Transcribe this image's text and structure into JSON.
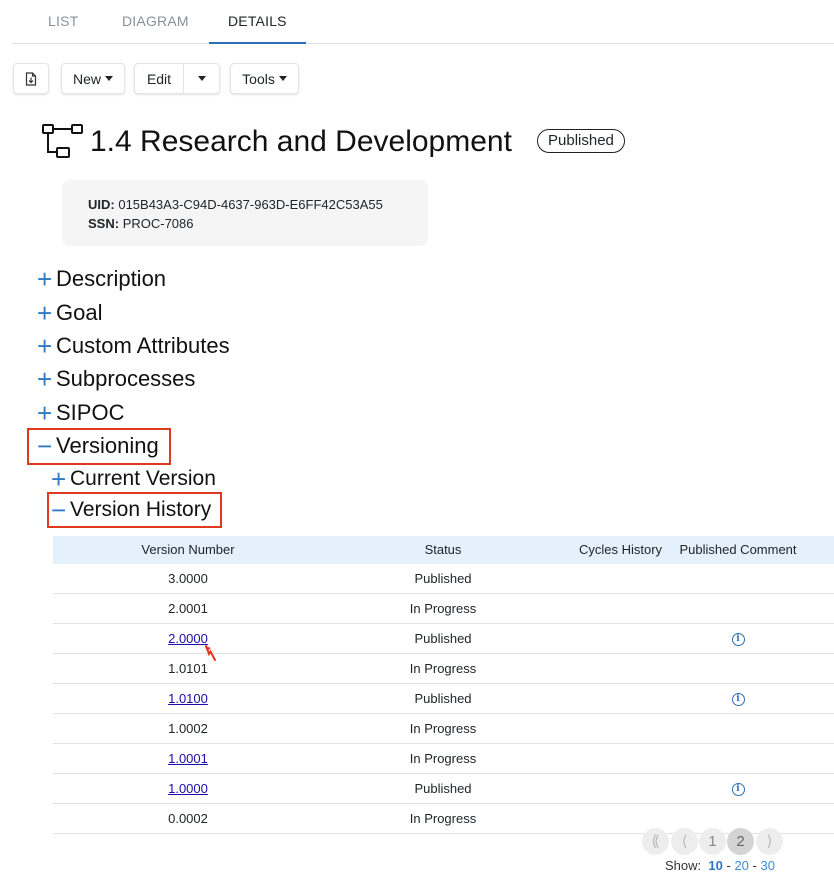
{
  "tabs": [
    {
      "label": "LIST"
    },
    {
      "label": "DIAGRAM"
    },
    {
      "label": "DETAILS",
      "active": true
    }
  ],
  "toolbar": {
    "export_icon": "file-export-icon",
    "new_label": "New",
    "edit_label": "Edit",
    "tools_label": "Tools"
  },
  "process": {
    "icon": "process-tree-icon",
    "title": "1.4 Research and Development",
    "status": "Published",
    "uid_label": "UID:",
    "uid": "015B43A3-C94D-4637-963D-E6FF42C53A55",
    "ssn_label": "SSN:",
    "ssn": "PROC-7086"
  },
  "sections": [
    {
      "label": "Description",
      "expanded": false
    },
    {
      "label": "Goal",
      "expanded": false
    },
    {
      "label": "Custom Attributes",
      "expanded": false
    },
    {
      "label": "Subprocesses",
      "expanded": false
    },
    {
      "label": "SIPOC",
      "expanded": false
    },
    {
      "label": "Versioning",
      "expanded": true
    }
  ],
  "subsections": [
    {
      "label": "Current Version",
      "expanded": false
    },
    {
      "label": "Version History",
      "expanded": true
    }
  ],
  "symbols": {
    "collapsed": "+",
    "expanded": "−"
  },
  "table": {
    "headers": [
      "Version Number",
      "Status",
      "Cycles History",
      "Published Comment"
    ],
    "rows": [
      {
        "version": "3.0000",
        "link": false,
        "status": "Published",
        "comment_icon": false
      },
      {
        "version": "2.0001",
        "link": false,
        "status": "In Progress",
        "comment_icon": false
      },
      {
        "version": "2.0000",
        "link": true,
        "status": "Published",
        "comment_icon": true
      },
      {
        "version": "1.0101",
        "link": false,
        "status": "In Progress",
        "comment_icon": false
      },
      {
        "version": "1.0100",
        "link": true,
        "status": "Published",
        "comment_icon": true
      },
      {
        "version": "1.0002",
        "link": false,
        "status": "In Progress",
        "comment_icon": false
      },
      {
        "version": "1.0001",
        "link": true,
        "status": "In Progress",
        "comment_icon": false
      },
      {
        "version": "1.0000",
        "link": true,
        "status": "Published",
        "comment_icon": true
      },
      {
        "version": "0.0002",
        "link": false,
        "status": "In Progress",
        "comment_icon": false
      }
    ],
    "comment_glyph": "i"
  },
  "pagination": {
    "first": "⟪",
    "prev": "⟨",
    "pages": [
      "1",
      "2"
    ],
    "current_page": "2",
    "next": "⟩",
    "show_label": "Show:",
    "sizes": [
      "10",
      "20",
      "30"
    ],
    "current_size": "10",
    "separator": "-"
  },
  "colors": {
    "accent": "#2f78c4",
    "highlight": "#e03a1e",
    "header_bg": "#e4f0fb"
  }
}
